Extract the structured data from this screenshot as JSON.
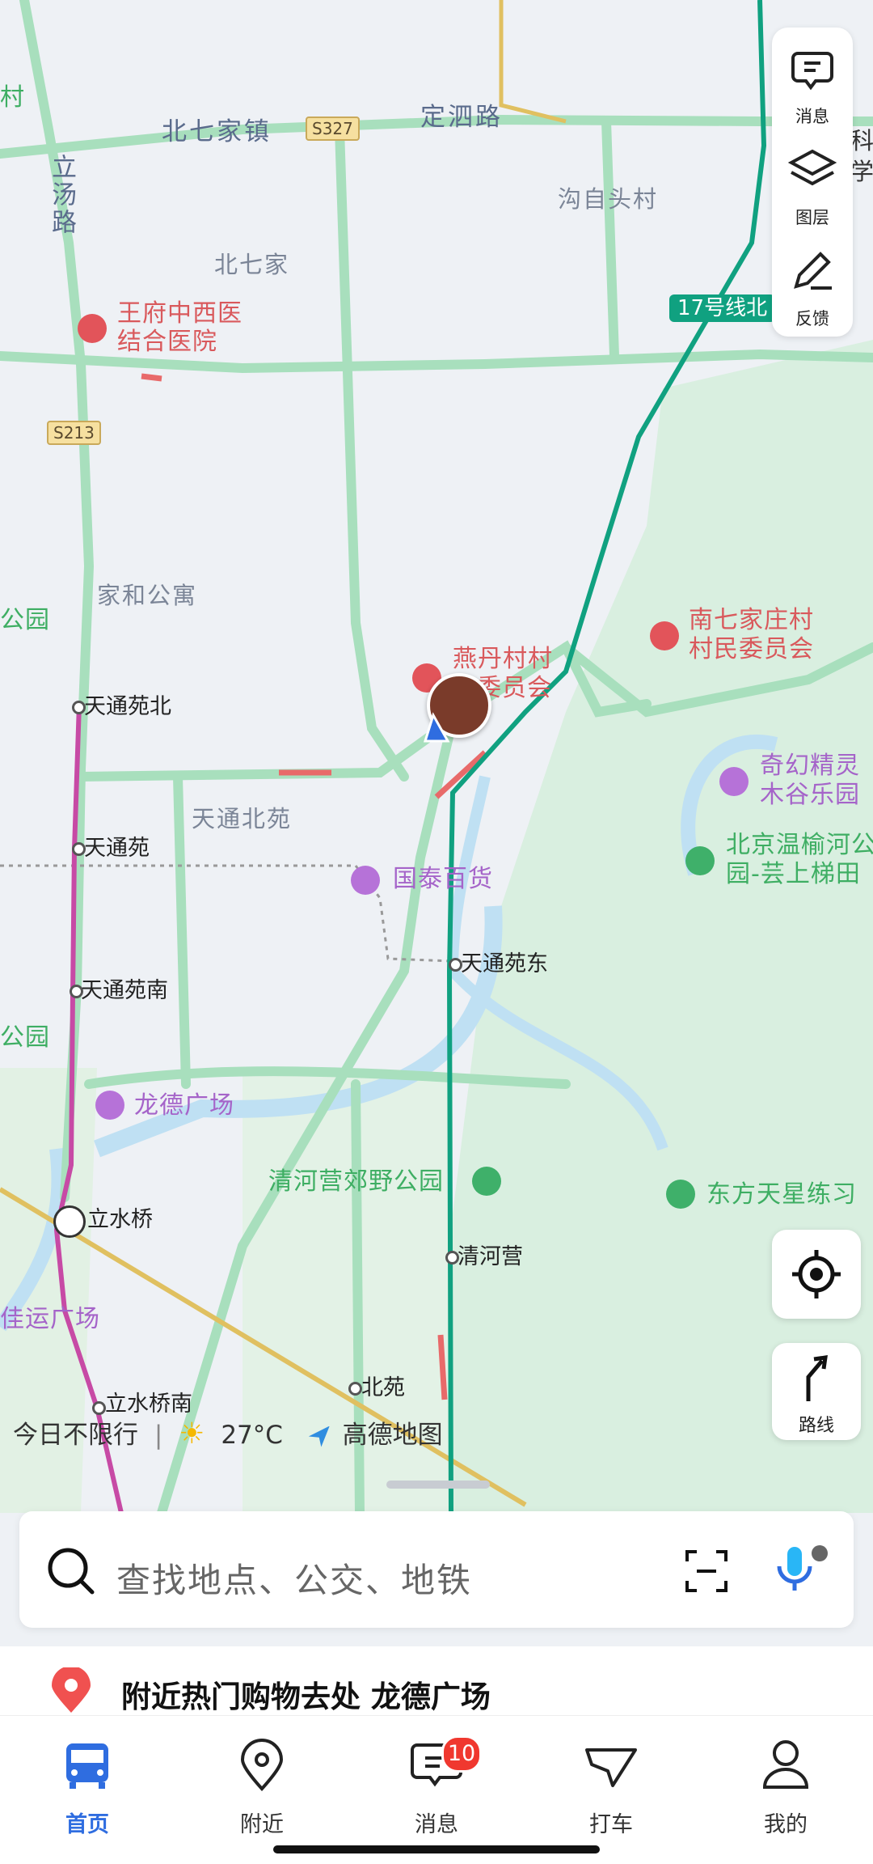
{
  "map": {
    "roads": [
      "北七家镇",
      "定泗路",
      "立汤路"
    ],
    "shields": [
      "S327",
      "S213"
    ],
    "places": [
      "沟自头村",
      "北七家",
      "家和公寓",
      "天通北苑"
    ],
    "pois": {
      "hospital": "王府中西医结合医院",
      "hospital_line1": "王府中西医",
      "hospital_line2": "结合医院",
      "village_cmte_1_line1": "燕丹村村",
      "village_cmte_1_line2": "委员会",
      "village_cmte_2_line1": "南七家庄村",
      "village_cmte_2_line2": "村民委员会",
      "mall_guotai": "国泰百货",
      "mall_longde": "龙德广场",
      "amusement_line1": "奇幻精灵",
      "amusement_line2": "木谷乐园",
      "park_wenyu_line1": "北京温榆河公",
      "park_wenyu_line2": "园-芸上梯田",
      "park_qinghe": "清河营郊野公园",
      "park_dongfang": "东方天星练习",
      "edge_park_1": "公园",
      "edge_park_2": "公园",
      "edge_left_1": "村",
      "edge_right_1": "学",
      "edge_right_2": "科",
      "edge_plaza": "佳运广场"
    },
    "metro_line_label": "17号线北",
    "stations": [
      "天通苑北",
      "天通苑",
      "天通苑南",
      "立水桥",
      "立水桥南",
      "天通苑东",
      "清河营",
      "北苑"
    ]
  },
  "tools": [
    {
      "label": "消息",
      "icon": "message-icon"
    },
    {
      "label": "图层",
      "icon": "layers-icon"
    },
    {
      "label": "反馈",
      "icon": "feedback-icon"
    }
  ],
  "locate_icon": "locate-icon",
  "route_label": "路线",
  "weather": {
    "restriction": "今日不限行",
    "separator": "|",
    "temperature": "27°C",
    "brand": "高德地图"
  },
  "search": {
    "placeholder": "查找地点、公交、地铁"
  },
  "hint": {
    "text": "附近热门购物去处 龙德广场"
  },
  "tabs": [
    {
      "label": "首页",
      "active": true
    },
    {
      "label": "附近",
      "active": false
    },
    {
      "label": "消息",
      "active": false,
      "badge": "10"
    },
    {
      "label": "打车",
      "active": false
    },
    {
      "label": "我的",
      "active": false
    }
  ],
  "colors": {
    "accent": "#2f6de0",
    "metro17": "#10a180",
    "metro5": "#c74aa5",
    "road_green": "#9fdcb4",
    "badge": "#f0382f"
  }
}
